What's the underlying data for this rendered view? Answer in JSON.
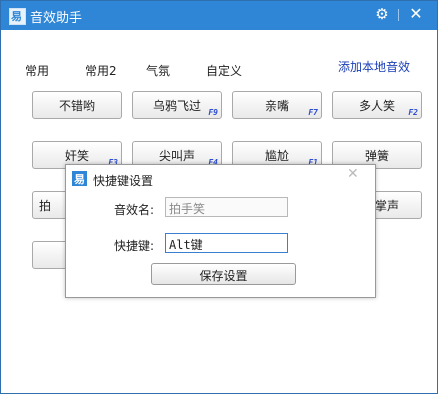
{
  "window": {
    "title": "音效助手",
    "gear_icon": "gear-icon",
    "close_icon": "close-icon"
  },
  "tabs": [
    "常用",
    "常用2",
    "气氛",
    "自定义"
  ],
  "add_local_link": "添加本地音效",
  "sound_buttons": [
    {
      "label": "不错哟",
      "key": ""
    },
    {
      "label": "乌鸦飞过",
      "key": "F9"
    },
    {
      "label": "亲嘴",
      "key": "F7"
    },
    {
      "label": "多人笑",
      "key": "F2"
    },
    {
      "label": "奸笑",
      "key": "F3"
    },
    {
      "label": "尖叫声",
      "key": "F4"
    },
    {
      "label": "尴尬",
      "key": "F1"
    },
    {
      "label": "弹簧",
      "key": ""
    },
    {
      "label": "拍",
      "key": ""
    },
    {
      "label": "掌声",
      "key": ""
    }
  ],
  "dialog": {
    "title": "快捷键设置",
    "sound_name_label": "音效名:",
    "sound_name_value": "拍手笑",
    "hotkey_label": "快捷键:",
    "hotkey_value": "Alt键",
    "save_label": "保存设置"
  }
}
